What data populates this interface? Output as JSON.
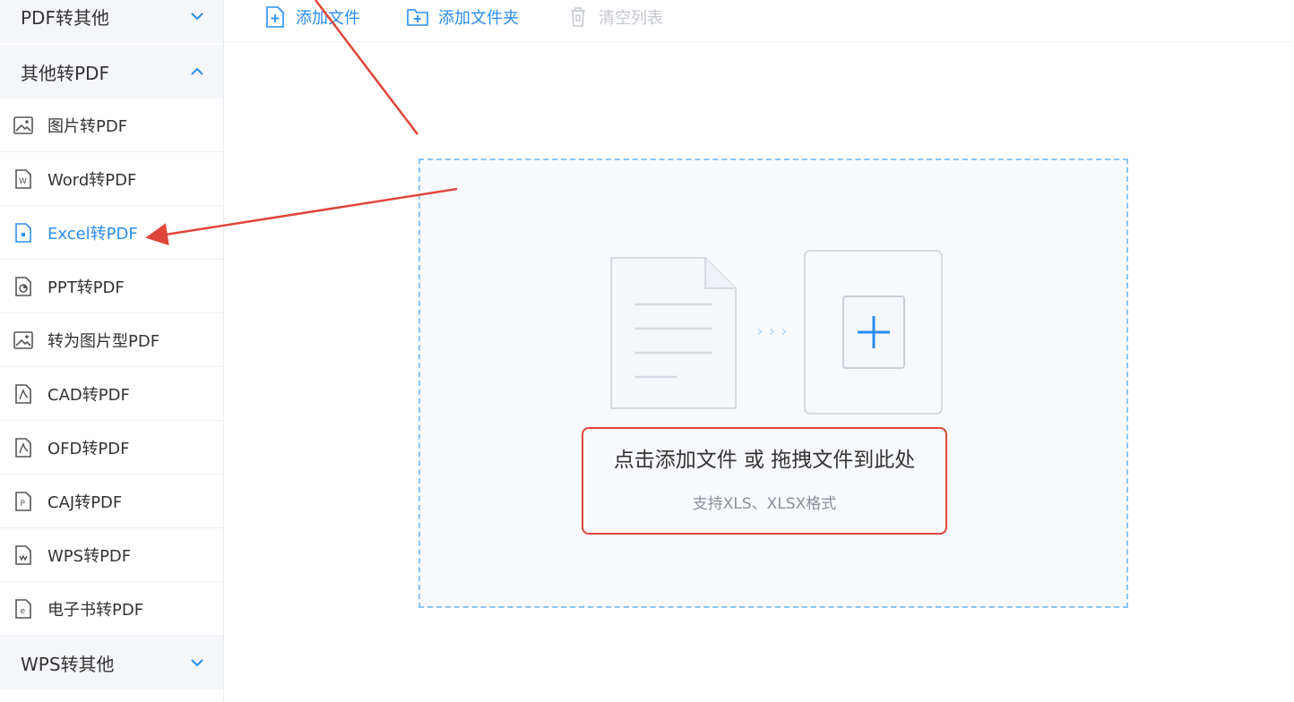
{
  "sidebar": {
    "groups": [
      {
        "label": "PDF转其他",
        "state": "collapsed"
      },
      {
        "label": "其他转PDF",
        "state": "expanded"
      },
      {
        "label": "WPS转其他",
        "state": "collapsed"
      }
    ],
    "items": [
      {
        "label": "图片转PDF",
        "icon": "image-file-icon"
      },
      {
        "label": "Word转PDF",
        "icon": "word-file-icon"
      },
      {
        "label": "Excel转PDF",
        "icon": "excel-file-icon",
        "active": true
      },
      {
        "label": "PPT转PDF",
        "icon": "ppt-file-icon"
      },
      {
        "label": "转为图片型PDF",
        "icon": "image-file-icon"
      },
      {
        "label": "CAD转PDF",
        "icon": "pdf-file-icon"
      },
      {
        "label": "OFD转PDF",
        "icon": "pdf-file-icon"
      },
      {
        "label": "CAJ转PDF",
        "icon": "caj-file-icon"
      },
      {
        "label": "WPS转PDF",
        "icon": "wps-file-icon"
      },
      {
        "label": "电子书转PDF",
        "icon": "ebook-file-icon"
      }
    ]
  },
  "toolbar": {
    "add_file": "添加文件",
    "add_folder": "添加文件夹",
    "clear_list": "清空列表"
  },
  "dropzone": {
    "main_text": "点击添加文件 或 拖拽文件到此处",
    "sub_text": "支持XLS、XLSX格式",
    "arrow_glyph": "› › ›"
  },
  "colors": {
    "accent": "#2a8df0",
    "annotation_red": "#e0453a",
    "sidebar_group_bg": "#f4f6f9",
    "dropzone_border": "#8cc4f2"
  }
}
